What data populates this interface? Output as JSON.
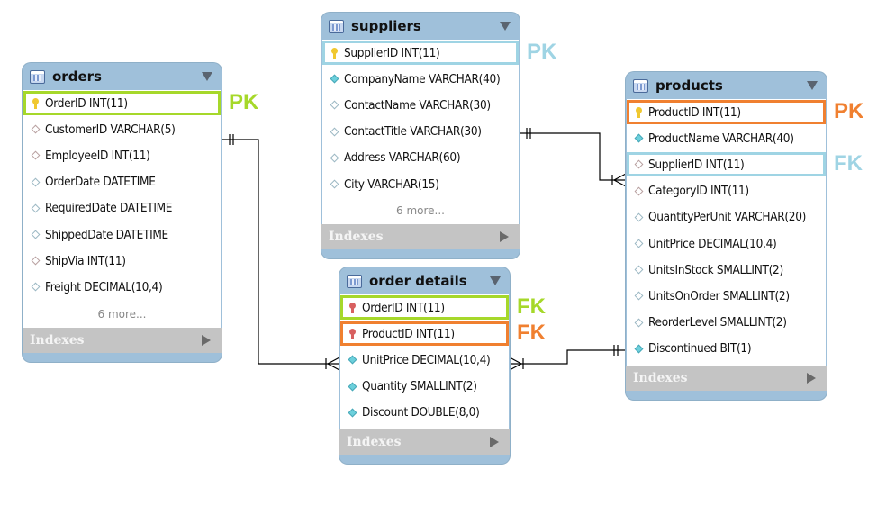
{
  "colors": {
    "green": "#a6d82a",
    "blue": "#9fd4e4",
    "orange": "#f08030"
  },
  "tables": [
    {
      "id": "orders",
      "name": "orders",
      "more": "6 more...",
      "indexes": "Indexes",
      "columns": [
        {
          "text": "OrderID INT(11)",
          "icon": "pk"
        },
        {
          "text": "CustomerID VARCHAR(5)",
          "icon": "fk"
        },
        {
          "text": "EmployeeID INT(11)",
          "icon": "fk"
        },
        {
          "text": "OrderDate DATETIME",
          "icon": "nul"
        },
        {
          "text": "RequiredDate DATETIME",
          "icon": "nul"
        },
        {
          "text": "ShippedDate DATETIME",
          "icon": "nul"
        },
        {
          "text": "ShipVia INT(11)",
          "icon": "fk"
        },
        {
          "text": "Freight DECIMAL(10,4)",
          "icon": "nul"
        }
      ]
    },
    {
      "id": "suppliers",
      "name": "suppliers",
      "more": "6 more...",
      "indexes": "Indexes",
      "columns": [
        {
          "text": "SupplierID INT(11)",
          "icon": "pk"
        },
        {
          "text": "CompanyName VARCHAR(40)",
          "icon": "nn"
        },
        {
          "text": "ContactName VARCHAR(30)",
          "icon": "nul"
        },
        {
          "text": "ContactTitle VARCHAR(30)",
          "icon": "nul"
        },
        {
          "text": "Address VARCHAR(60)",
          "icon": "nul"
        },
        {
          "text": "City VARCHAR(15)",
          "icon": "nul"
        }
      ]
    },
    {
      "id": "products",
      "name": "products",
      "indexes": "Indexes",
      "columns": [
        {
          "text": "ProductID INT(11)",
          "icon": "pk"
        },
        {
          "text": "ProductName VARCHAR(40)",
          "icon": "nn"
        },
        {
          "text": "SupplierID INT(11)",
          "icon": "fk"
        },
        {
          "text": "CategoryID INT(11)",
          "icon": "fk"
        },
        {
          "text": "QuantityPerUnit VARCHAR(20)",
          "icon": "nul"
        },
        {
          "text": "UnitPrice DECIMAL(10,4)",
          "icon": "nul"
        },
        {
          "text": "UnitsInStock SMALLINT(2)",
          "icon": "nul"
        },
        {
          "text": "UnitsOnOrder SMALLINT(2)",
          "icon": "nul"
        },
        {
          "text": "ReorderLevel SMALLINT(2)",
          "icon": "nul"
        },
        {
          "text": "Discontinued BIT(1)",
          "icon": "nn"
        }
      ]
    },
    {
      "id": "order-details",
      "name": "order details",
      "indexes": "Indexes",
      "columns": [
        {
          "text": "OrderID INT(11)",
          "icon": "pfk"
        },
        {
          "text": "ProductID INT(11)",
          "icon": "pfk"
        },
        {
          "text": "UnitPrice DECIMAL(10,4)",
          "icon": "nn"
        },
        {
          "text": "Quantity SMALLINT(2)",
          "icon": "nn"
        },
        {
          "text": "Discount DOUBLE(8,0)",
          "icon": "nn"
        }
      ]
    }
  ],
  "annotations": [
    {
      "table": "orders",
      "row": 0,
      "label": "PK",
      "color": "green"
    },
    {
      "table": "suppliers",
      "row": 0,
      "label": "PK",
      "color": "blue"
    },
    {
      "table": "products",
      "row": 0,
      "label": "PK",
      "color": "orange"
    },
    {
      "table": "products",
      "row": 2,
      "label": "FK",
      "color": "blue"
    },
    {
      "table": "order-details",
      "row": 0,
      "label": "FK",
      "color": "green"
    },
    {
      "table": "order-details",
      "row": 1,
      "label": "FK",
      "color": "orange"
    }
  ],
  "relationships": [
    {
      "from": "orders",
      "to": "order details",
      "cardinality": "one-to-many"
    },
    {
      "from": "suppliers",
      "to": "products",
      "cardinality": "one-to-many"
    },
    {
      "from": "products",
      "to": "order details",
      "cardinality": "one-to-many"
    }
  ]
}
